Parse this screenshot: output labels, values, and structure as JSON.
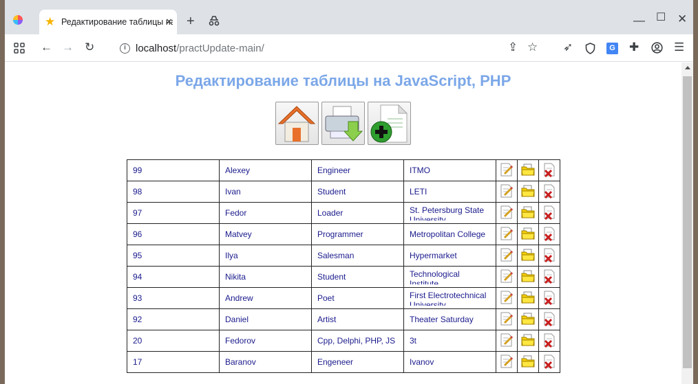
{
  "browser": {
    "tab_title": "Редактирование таблицы на JavaScript, PHP",
    "url_host": "localhost",
    "url_path": "/practUpdate-main/"
  },
  "page": {
    "heading": "Редактирование таблицы на JavaScript, PHP"
  },
  "toolbar_icons": [
    "home-icon",
    "print-download-icon",
    "add-document-icon"
  ],
  "row_action_icons": [
    "edit-icon",
    "open-folder-icon",
    "delete-icon"
  ],
  "colors": {
    "heading": "#7ba7e8",
    "cell_text": "#1a1a8c"
  },
  "rows": [
    {
      "id": "99",
      "name": "Alexey",
      "job": "Engineer",
      "org": "ITMO"
    },
    {
      "id": "98",
      "name": "Ivan",
      "job": "Student",
      "org": "LETI"
    },
    {
      "id": "97",
      "name": "Fedor",
      "job": "Loader",
      "org": "St. Petersburg State University"
    },
    {
      "id": "96",
      "name": "Matvey",
      "job": "Programmer",
      "org": "Metropolitan College"
    },
    {
      "id": "95",
      "name": "Ilya",
      "job": "Salesman",
      "org": "Hypermarket"
    },
    {
      "id": "94",
      "name": "Nikita",
      "job": "Student",
      "org": "Technological Institute"
    },
    {
      "id": "93",
      "name": "Andrew",
      "job": "Poet",
      "org": "First Electrotechnical University"
    },
    {
      "id": "92",
      "name": "Daniel",
      "job": "Artist",
      "org": "Theater Saturday"
    },
    {
      "id": "20",
      "name": "Fedorov",
      "job": "Cpp, Delphi, PHP, JS",
      "org": "3t"
    },
    {
      "id": "17",
      "name": "Baranov",
      "job": "Engeneer",
      "org": "Ivanov"
    }
  ]
}
